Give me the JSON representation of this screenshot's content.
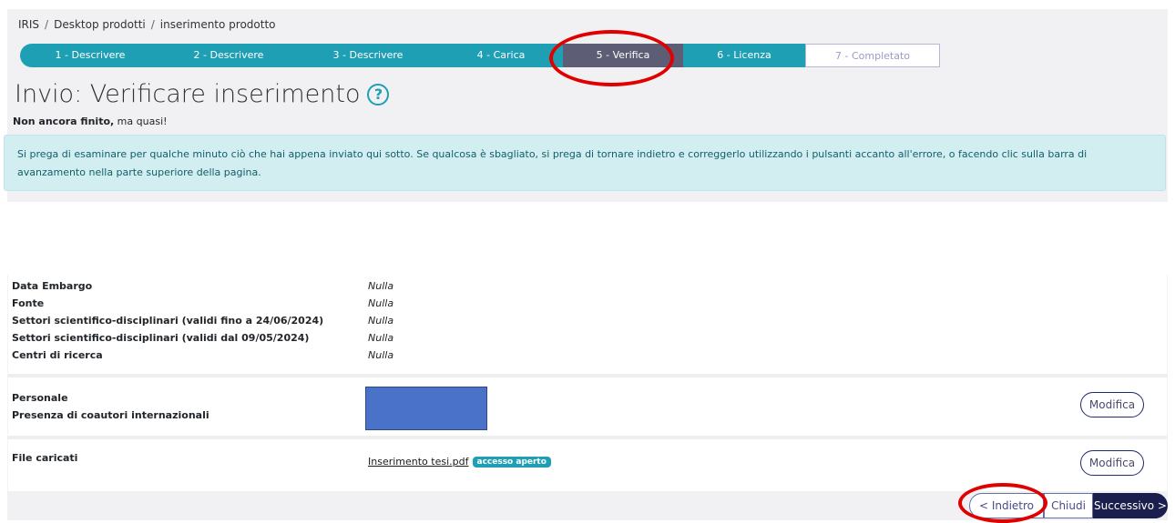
{
  "breadcrumb": [
    "IRIS",
    "Desktop prodotti",
    "inserimento prodotto"
  ],
  "breadcrumb_sep": "/",
  "steps": [
    "1 - Descrivere",
    "2 - Descrivere",
    "3 - Descrivere",
    "4 - Carica",
    "5 - Verifica",
    "6 - Licenza",
    "7 - Completato"
  ],
  "active_step": 4,
  "page_title": "Invio: Verificare inserimento",
  "help_icon": "?",
  "subtitle": {
    "bold": "Non ancora finito,",
    "rest": " ma quasi!"
  },
  "alert": "Si prega di esaminare per qualche minuto ciò che hai appena inviato qui sotto. Se qualcosa è sbagliato, si prega di tornare indietro e correggerlo utilizzando i pulsanti accanto all'errore, o facendo clic sulla barra di avanzamento nella parte superiore della pagina.",
  "section1": [
    {
      "label": "Data Embargo",
      "value": "Nulla"
    },
    {
      "label": "Fonte",
      "value": "Nulla"
    },
    {
      "label": "Settori scientifico-disciplinari (validi fino a 24/06/2024)",
      "value": "Nulla"
    },
    {
      "label": "Settori scientifico-disciplinari (validi dal 09/05/2024)",
      "value": "Nulla"
    },
    {
      "label": "Centri di ricerca",
      "value": "Nulla"
    }
  ],
  "section2": {
    "labels": [
      "Personale",
      "Presenza di coautori internazionali"
    ],
    "modify_label": "Modifica"
  },
  "section3": {
    "label": "File caricati",
    "file_name": "Inserimento tesi.pdf",
    "badge": "accesso aperto",
    "modify_label": "Modifica"
  },
  "nav": {
    "back": "< Indietro",
    "close": "Chiudi",
    "next": "Successivo >"
  },
  "colors": {
    "accent": "#1e9fb3",
    "active_step": "#5d5e76",
    "highlight": "#e10000",
    "dark_button": "#1b1f4d"
  }
}
